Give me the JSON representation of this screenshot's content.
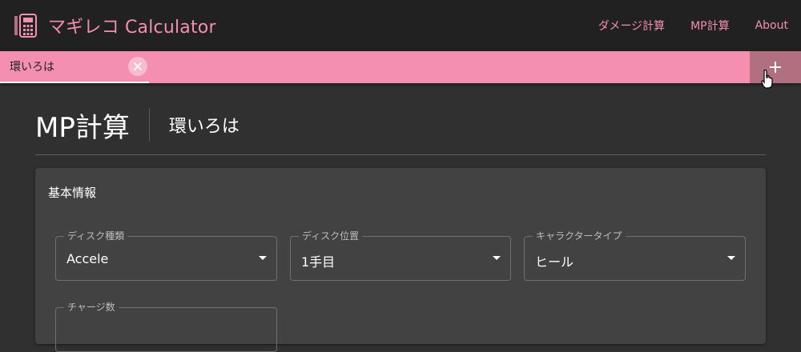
{
  "app": {
    "title": "マギレコ Calculator",
    "logo_icon": "calculator-icon",
    "accent_color": "#f48fb1"
  },
  "nav": {
    "items": [
      {
        "label": "ダメージ計算"
      },
      {
        "label": "MP計算"
      },
      {
        "label": "About"
      }
    ]
  },
  "tabs": {
    "items": [
      {
        "label": "環いろは",
        "close_icon": "close-icon"
      }
    ],
    "add_icon": "plus-icon"
  },
  "page": {
    "title": "MP計算",
    "subtitle": "環いろは"
  },
  "card": {
    "title": "基本情報",
    "fields": [
      {
        "label": "ディスク種類",
        "value": "Accele"
      },
      {
        "label": "ディスク位置",
        "value": "1手目"
      },
      {
        "label": "キャラクタータイプ",
        "value": "ヒール"
      },
      {
        "label": "チャージ数",
        "value": ""
      }
    ]
  }
}
